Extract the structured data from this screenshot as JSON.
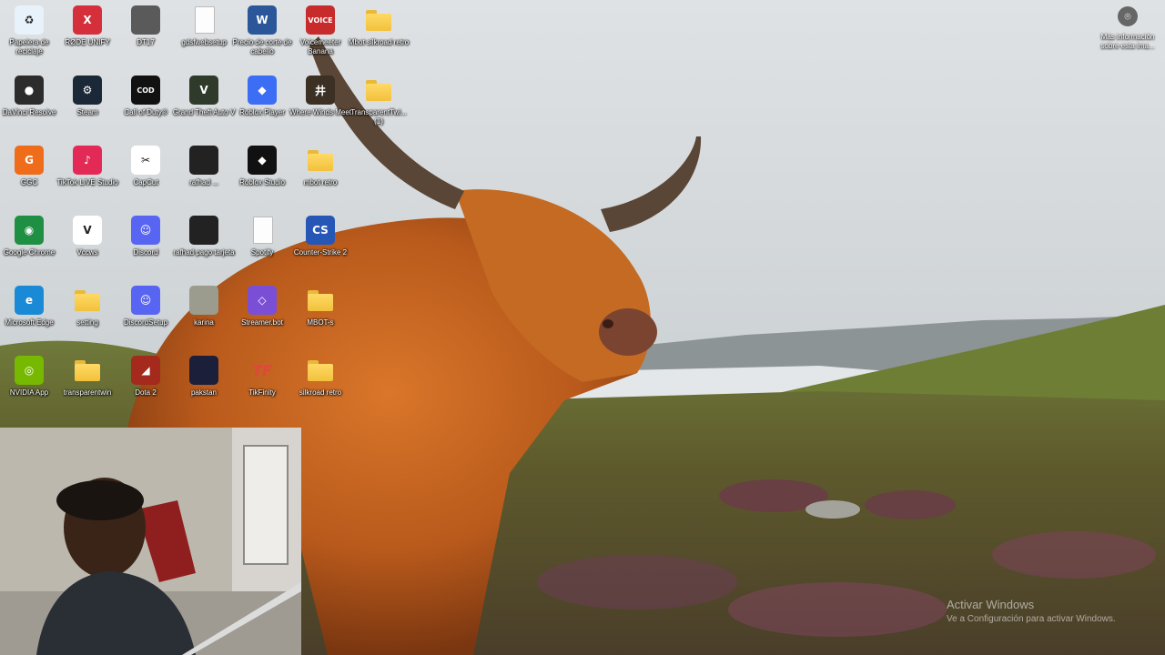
{
  "desktop": {
    "icons": [
      {
        "label": "Papelera de reciclaje",
        "icon": "recycle-bin-icon",
        "glyph": "♻",
        "color": "#e8f2fb"
      },
      {
        "label": "RØDE UNIFY",
        "icon": "rode-unify-icon",
        "glyph": "X",
        "color": "#d42f3b"
      },
      {
        "label": "DT17",
        "icon": "device-icon",
        "glyph": "",
        "color": "#5a5a5a"
      },
      {
        "label": "gdsfwebsetup",
        "icon": "document-icon",
        "glyph": "",
        "color": "#ffffff"
      },
      {
        "label": "Precio de corte de cabello",
        "icon": "word-document-icon",
        "glyph": "W",
        "color": "#2b579a"
      },
      {
        "label": "Voicemeeter Banana",
        "icon": "voicemeeter-icon",
        "glyph": "VOICE",
        "color": "#c72b2b"
      },
      {
        "label": "Mbot silkroad retro",
        "icon": "folder-icon",
        "glyph": "",
        "color": "#f2c13c"
      },
      {
        "label": "DaVinci Resolve",
        "icon": "davinci-resolve-icon",
        "glyph": "●",
        "color": "#2c2c2c"
      },
      {
        "label": "Steam",
        "icon": "steam-icon",
        "glyph": "⚙",
        "color": "#1b2838"
      },
      {
        "label": "Call of Duty®",
        "icon": "call-of-duty-icon",
        "glyph": "COD",
        "color": "#111111"
      },
      {
        "label": "Grand Theft Auto V",
        "icon": "gta-v-icon",
        "glyph": "V",
        "color": "#2f3a2a"
      },
      {
        "label": "Roblox Player",
        "icon": "roblox-player-icon",
        "glyph": "◆",
        "color": "#3b6ef5"
      },
      {
        "label": "Where Winds Meet",
        "icon": "where-winds-meet-icon",
        "glyph": "井",
        "color": "#3c2f23"
      },
      {
        "label": "TransparentTwi... (1)",
        "icon": "folder-icon",
        "glyph": "",
        "color": "#f2c13c"
      },
      {
        "label": "GGC",
        "icon": "ggc-icon",
        "glyph": "G",
        "color": "#ef6c1b"
      },
      {
        "label": "TikTok LIVE Studio",
        "icon": "tiktok-live-icon",
        "glyph": "♪",
        "color": "#e32a56"
      },
      {
        "label": "CapCut",
        "icon": "capcut-icon",
        "glyph": "✂",
        "color": "#ffffff"
      },
      {
        "label": "rafhad ...",
        "icon": "image-icon",
        "glyph": "",
        "color": "#222222"
      },
      {
        "label": "Roblox Studio",
        "icon": "roblox-studio-icon",
        "glyph": "◆",
        "color": "#111111"
      },
      {
        "label": "mbot retro",
        "icon": "folder-icon",
        "glyph": "",
        "color": "#f2c13c"
      },
      {
        "label": "Google Chrome",
        "icon": "chrome-icon",
        "glyph": "◉",
        "color": "#1f8f43"
      },
      {
        "label": "Vccws",
        "icon": "vccws-icon",
        "glyph": "V",
        "color": "#ffffff"
      },
      {
        "label": "Discord",
        "icon": "discord-icon",
        "glyph": "☺",
        "color": "#5865f2"
      },
      {
        "label": "rafhad pago tarjeta",
        "icon": "image-icon",
        "glyph": "",
        "color": "#222222"
      },
      {
        "label": "Spotify",
        "icon": "document-icon",
        "glyph": "",
        "color": "#ffffff"
      },
      {
        "label": "Counter-Strike 2",
        "icon": "counter-strike-icon",
        "glyph": "CS",
        "color": "#2657b6"
      },
      {
        "label": "Microsoft Edge",
        "icon": "edge-icon",
        "glyph": "e",
        "color": "#1b8ad6"
      },
      {
        "label": "setting",
        "icon": "folder-icon",
        "glyph": "",
        "color": "#f2c13c"
      },
      {
        "label": "DiscordSetup",
        "icon": "discord-icon",
        "glyph": "☺",
        "color": "#5865f2"
      },
      {
        "label": "karina",
        "icon": "archive-icon",
        "glyph": "",
        "color": "#9b9b8e"
      },
      {
        "label": "Streamer.bot",
        "icon": "streamerbot-icon",
        "glyph": "◇",
        "color": "#7a4fd6"
      },
      {
        "label": "MBOT-s",
        "icon": "folder-icon",
        "glyph": "",
        "color": "#f2c13c"
      },
      {
        "label": "NVIDIA App",
        "icon": "nvidia-icon",
        "glyph": "◎",
        "color": "#76b900"
      },
      {
        "label": "transparentwin",
        "icon": "folder-icon",
        "glyph": "",
        "color": "#f2c13c"
      },
      {
        "label": "Dota 2",
        "icon": "dota-2-icon",
        "glyph": "◢",
        "color": "#a32a1c"
      },
      {
        "label": "pakstan",
        "icon": "phone-image-icon",
        "glyph": "",
        "color": "#1c1f3a"
      },
      {
        "label": "TikFinity",
        "icon": "tikfinity-icon",
        "glyph": "TF",
        "color": "transparent"
      },
      {
        "label": "silkroad retro",
        "icon": "folder-icon",
        "glyph": "",
        "color": "#f2c13c"
      }
    ]
  },
  "info_button": {
    "label": "Más información sobre esta ima..."
  },
  "watermark": {
    "title": "Activar Windows",
    "subtitle": "Ve a Configuración para activar Windows."
  },
  "webcam": {
    "name": "webcam-overlay"
  }
}
